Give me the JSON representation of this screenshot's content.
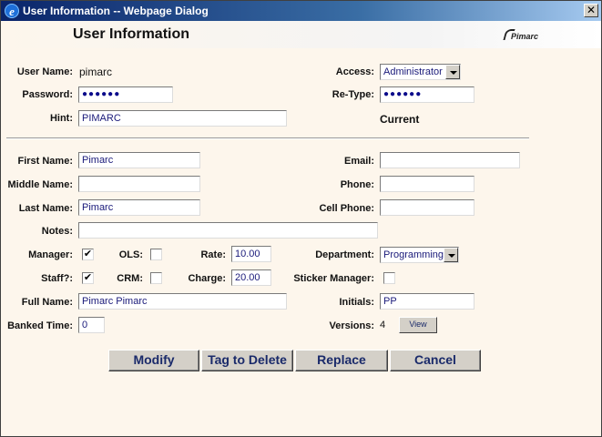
{
  "window": {
    "title": "User Information -- Webpage Dialog",
    "close_symbol": "✕"
  },
  "page": {
    "title": "User Information",
    "logo_text": "Pimarc"
  },
  "labels": {
    "user_name": "User Name:",
    "password": "Password:",
    "hint": "Hint:",
    "access": "Access:",
    "retype": "Re-Type:",
    "current": "Current",
    "first_name": "First Name:",
    "middle_name": "Middle Name:",
    "last_name": "Last Name:",
    "notes": "Notes:",
    "manager": "Manager:",
    "ols": "OLS:",
    "rate": "Rate:",
    "department": "Department:",
    "staff": "Staff?:",
    "crm": "CRM:",
    "charge": "Charge:",
    "sticker_manager": "Sticker Manager:",
    "full_name": "Full Name:",
    "initials": "Initials:",
    "banked_time": "Banked Time:",
    "versions": "Versions:",
    "email": "Email:",
    "phone": "Phone:",
    "cell_phone": "Cell Phone:"
  },
  "values": {
    "user_name": "pimarc",
    "password_mask": "●●●●●●",
    "retype_mask": "●●●●●●",
    "hint": "PIMARC",
    "access": "Administrator",
    "first_name": "Pimarc",
    "middle_name": "",
    "last_name": "Pimarc",
    "email": "",
    "phone": "",
    "cell_phone": "",
    "notes": "",
    "rate": "10.00",
    "charge": "20.00",
    "department": "Programming",
    "full_name": "Pimarc Pimarc",
    "initials": "PP",
    "banked_time": "0",
    "versions": "4",
    "check_mark": "✔"
  },
  "checkboxes": {
    "manager": true,
    "ols": false,
    "staff": true,
    "crm": false,
    "sticker_manager": false
  },
  "buttons": {
    "view": "View",
    "modify": "Modify",
    "tag_to_delete": "Tag to Delete",
    "replace": "Replace",
    "cancel": "Cancel"
  },
  "colors": {
    "title_bar": "#0a246a",
    "background": "#fdf6ec",
    "button_text": "#1a2a6a"
  }
}
